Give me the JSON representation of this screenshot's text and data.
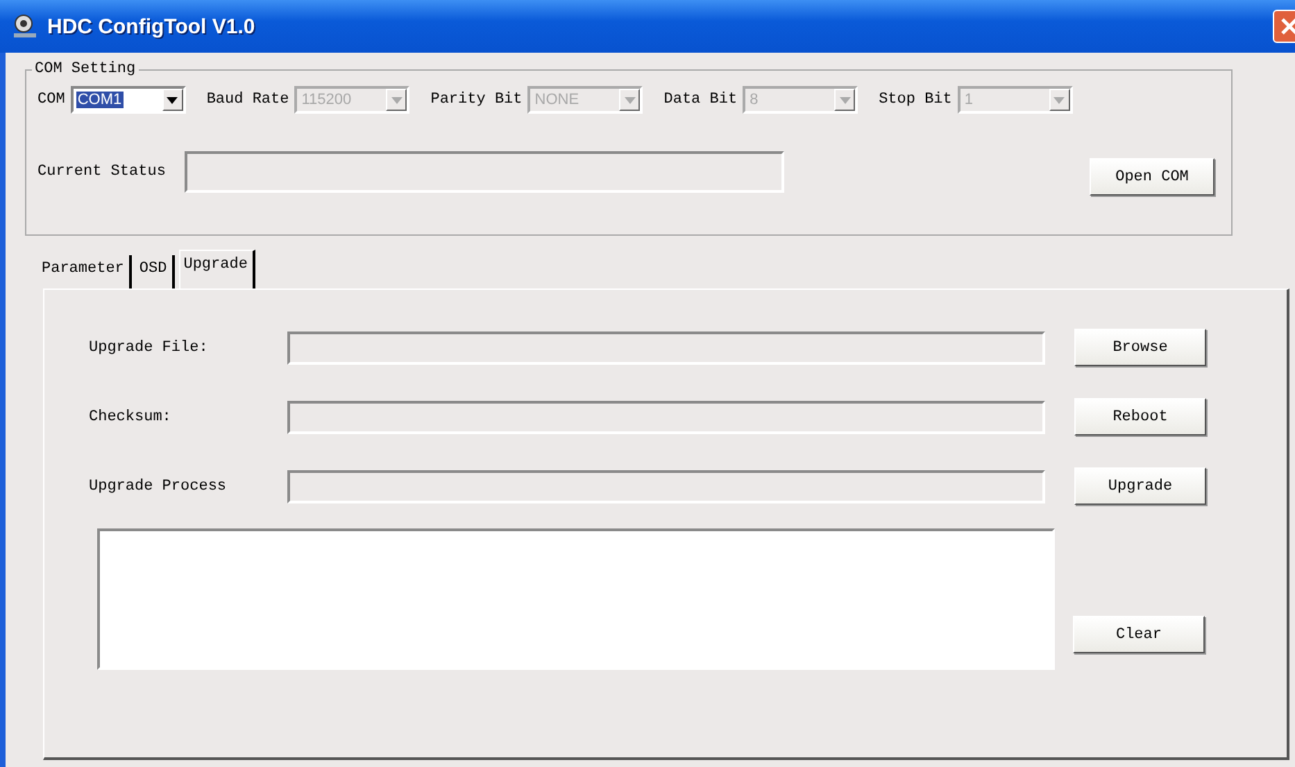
{
  "window": {
    "title": "HDC ConfigTool V1.0"
  },
  "com_setting": {
    "title": "COM Setting",
    "combos": [
      {
        "label": "COM",
        "value": "COM1",
        "disabled": false,
        "focused": true
      },
      {
        "label": "Baud Rate",
        "value": "115200",
        "disabled": true,
        "focused": false
      },
      {
        "label": "Parity Bit",
        "value": "NONE",
        "disabled": true,
        "focused": false
      },
      {
        "label": "Data Bit",
        "value": "8",
        "disabled": true,
        "focused": false
      },
      {
        "label": "Stop Bit",
        "value": "1",
        "disabled": true,
        "focused": false
      }
    ],
    "status_label": "Current Status",
    "open_button": "Open COM"
  },
  "tabs": [
    {
      "label": "Parameter",
      "selected": false
    },
    {
      "label": "OSD",
      "selected": false
    },
    {
      "label": "Upgrade",
      "selected": true
    }
  ],
  "upgrade": {
    "rows": [
      {
        "label": "Upgrade File:",
        "button": "Browse"
      },
      {
        "label": "Checksum:",
        "button": "Reboot"
      },
      {
        "label": "Upgrade Process",
        "button": "Upgrade"
      }
    ],
    "clear_button": "Clear"
  }
}
